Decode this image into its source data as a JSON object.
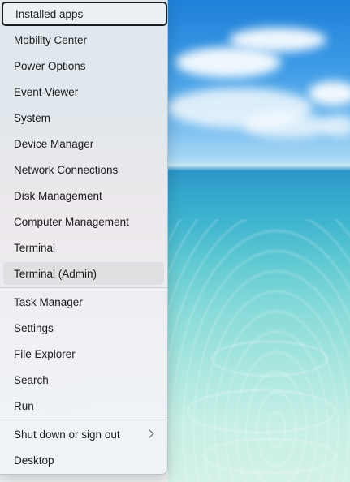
{
  "menu": {
    "items": [
      {
        "label": "Installed apps"
      },
      {
        "label": "Mobility Center"
      },
      {
        "label": "Power Options"
      },
      {
        "label": "Event Viewer"
      },
      {
        "label": "System"
      },
      {
        "label": "Device Manager"
      },
      {
        "label": "Network Connections"
      },
      {
        "label": "Disk Management"
      },
      {
        "label": "Computer Management"
      },
      {
        "label": "Terminal"
      },
      {
        "label": "Terminal (Admin)"
      },
      {
        "label": "Task Manager"
      },
      {
        "label": "Settings"
      },
      {
        "label": "File Explorer"
      },
      {
        "label": "Search"
      },
      {
        "label": "Run"
      },
      {
        "label": "Shut down or sign out"
      },
      {
        "label": "Desktop"
      }
    ]
  },
  "theme": {
    "menu_background": "#eef3f7",
    "text_color": "#1b1b1b",
    "focus_border": "#1c1c1c"
  }
}
